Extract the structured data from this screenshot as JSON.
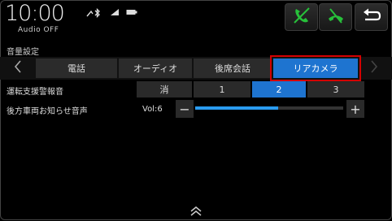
{
  "status": {
    "time": "10:00",
    "audio_state": "Audio OFF"
  },
  "section_title": "音量設定",
  "tabs": [
    {
      "label": "電話"
    },
    {
      "label": "オーディオ"
    },
    {
      "label": "後席会話"
    },
    {
      "label": "リアカメラ",
      "active": true
    }
  ],
  "alert_row": {
    "label": "運転支援警報音",
    "options": [
      "消",
      "1",
      "2",
      "3"
    ],
    "selected": "2"
  },
  "notice_row": {
    "label": "後方車両お知らせ音声",
    "volume_text": "Vol:6",
    "volume_level": 6,
    "volume_fraction": 0.56,
    "minus": "−",
    "plus": "+"
  },
  "colors": {
    "accent": "#1e74d0",
    "highlight_border": "#d40000",
    "slider": "#2a9cf0",
    "phone_off_icon": "#27c03a"
  },
  "icons": [
    "bluetooth-icon",
    "signal-icon",
    "battery-icon",
    "phone-off-icon",
    "phone-hangup-off-icon",
    "back-icon",
    "chevron-left-icon",
    "chevron-right-icon",
    "chevron-double-up-icon"
  ]
}
